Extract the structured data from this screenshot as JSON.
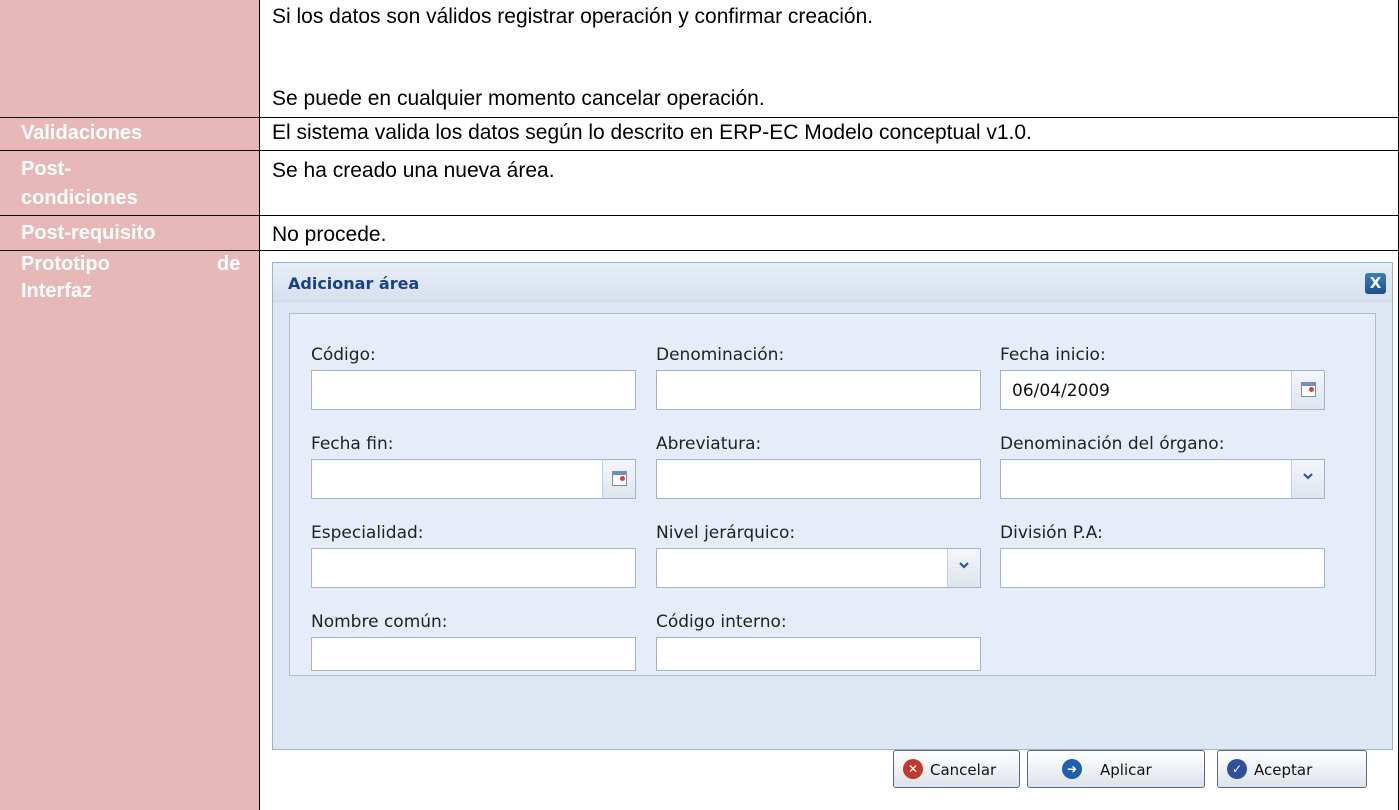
{
  "rows": {
    "flow": {
      "label": "",
      "line1": "Si los datos son válidos registrar operación y confirmar creación.",
      "line2": "Se puede en cualquier momento cancelar operación."
    },
    "validaciones": {
      "label": "Validaciones",
      "text": "El sistema valida los datos según lo descrito en ERP-EC Modelo conceptual v1.0."
    },
    "postcondiciones": {
      "label_line1": "Post-",
      "label_line2": "condiciones",
      "text": "Se ha creado una nueva área."
    },
    "postrequisito": {
      "label": "Post-requisito",
      "text": "No procede."
    },
    "prototipo": {
      "label_word1": "Prototipo",
      "label_word2": "de",
      "label_line2": "Interfaz"
    }
  },
  "dialog": {
    "title": "Adicionar área",
    "close_icon": "close-icon",
    "fields": {
      "codigo": {
        "label": "Código:",
        "value": ""
      },
      "denominacion": {
        "label": "Denominación:",
        "value": ""
      },
      "fecha_inicio": {
        "label": "Fecha inicio:",
        "value": "06/04/2009"
      },
      "fecha_fin": {
        "label": "Fecha fin:",
        "value": ""
      },
      "abreviatura": {
        "label": "Abreviatura:",
        "value": ""
      },
      "denominacion_organo": {
        "label": "Denominación del órgano:",
        "value": ""
      },
      "especialidad": {
        "label": "Especialidad:",
        "value": ""
      },
      "nivel_jerarquico": {
        "label": "Nivel jerárquico:",
        "value": ""
      },
      "division_pa": {
        "label": "División P.A:",
        "value": ""
      },
      "nombre_comun": {
        "label": "Nombre común:",
        "value": ""
      },
      "codigo_interno": {
        "label": "Código interno:",
        "value": ""
      }
    },
    "buttons": {
      "cancel": {
        "label": "Cancelar",
        "icon": "cancel-icon",
        "color": "#c0392b"
      },
      "apply": {
        "label": "Aplicar",
        "icon": "refresh-icon",
        "color": "#1f5fae"
      },
      "accept": {
        "label": "Aceptar",
        "icon": "check-icon",
        "color": "#2d4f9c"
      }
    }
  },
  "colors": {
    "label_bg": "#e6b8b8",
    "dialog_bg": "#dde6f2",
    "dialog_title": "#15428b"
  }
}
